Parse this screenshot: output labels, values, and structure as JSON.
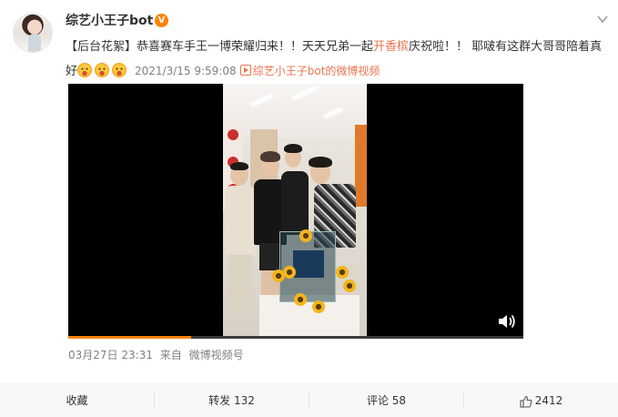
{
  "user": {
    "name": "综艺小王子bot",
    "verified_badge": "V"
  },
  "post": {
    "text_before": "【后台花絮】恭喜赛车手王一博荣耀归来！！天天兄弟一起",
    "text_highlight": "开香槟",
    "text_after": "庆祝啦！！ 耶啵有这群大哥哥陪着真好",
    "emoji_count": 3,
    "timestamp": "2021/3/15 9:59:08",
    "source_link": "综艺小王子bot的微博视频"
  },
  "video": {
    "progress": 0.27
  },
  "meta": {
    "date": "03月27日 23:31",
    "via_prefix": "来自",
    "via_source": "微博视频号"
  },
  "actions": {
    "favorite": "收藏",
    "repost_label": "转发",
    "repost_count": "132",
    "comment_label": "评论",
    "comment_count": "58",
    "like_count": "2412"
  },
  "colors": {
    "accent": "#eb7350",
    "brand_orange": "#ff8200",
    "meta_gray": "#808080"
  }
}
